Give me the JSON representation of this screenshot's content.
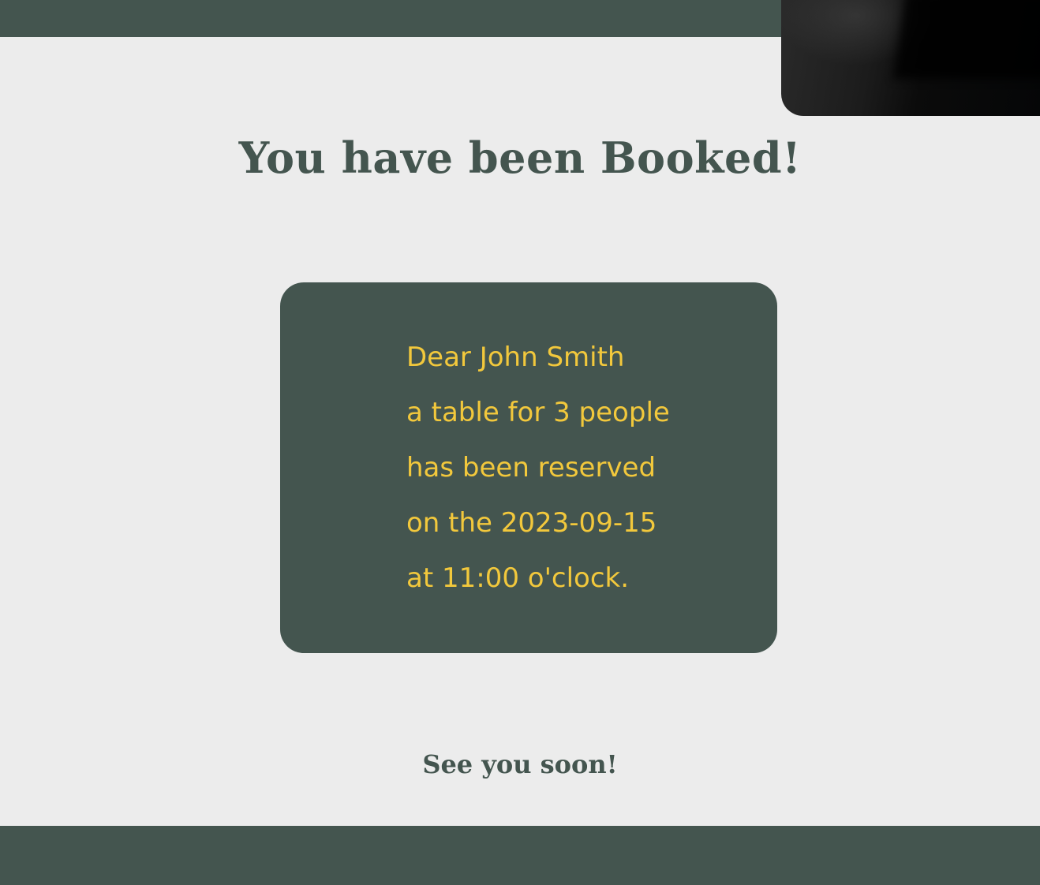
{
  "page": {
    "title": "You have been Booked!",
    "closing": "See you soon!"
  },
  "confirmation": {
    "lines": [
      "Dear John Smith",
      "a table for 3 people",
      "has been reserved",
      "on the 2023-09-15",
      "at 11:00 o'clock."
    ]
  },
  "colors": {
    "primary": "#44554f",
    "accent": "#f2c83c",
    "background": "#ececec"
  }
}
